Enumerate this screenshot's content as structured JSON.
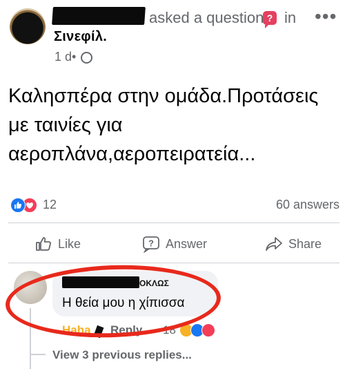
{
  "header": {
    "asked_text": "asked a question",
    "in_text": "in",
    "group_name": "Σινεφίλ.",
    "time": "1 d",
    "dot": "•",
    "more": "•••",
    "question_icon": "?"
  },
  "post": {
    "text": "Καλησπέρα στην ομάδα.Προτάσεις με ταινίες για αεροπλάνα,αεροπειρατεία..."
  },
  "stats": {
    "reactions_count": "12",
    "answers": "60 answers"
  },
  "actions": {
    "like": "Like",
    "answer": "Answer",
    "share": "Share",
    "answer_icon": "?"
  },
  "comment": {
    "name_tail": "ΟΚΛΩΣ",
    "text": "Η θεία μου η χίπισσα",
    "haha": "Haha",
    "reply": "Reply",
    "reaction_count": "18",
    "view_previous": "View 3 previous replies..."
  },
  "colors": {
    "accent": "#1877f2",
    "love": "#f33e58",
    "haha": "#f7b125",
    "annotation": "#e8291c"
  }
}
